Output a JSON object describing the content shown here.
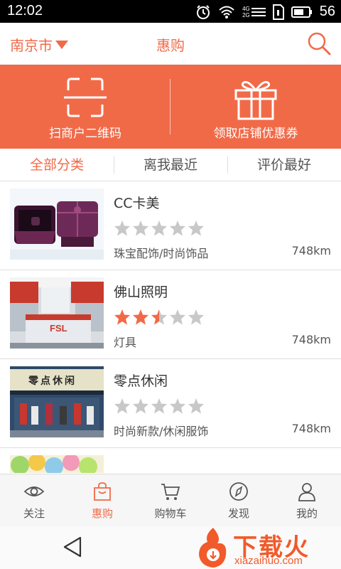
{
  "status": {
    "time": "12:02",
    "battery": "56",
    "signal_4g": "4G",
    "signal_2g": "2G"
  },
  "header": {
    "city": "南京市",
    "title": "惠购"
  },
  "banner": {
    "scan_label": "扫商户二维码",
    "coupon_label": "领取店铺优惠券"
  },
  "tabs": [
    {
      "label": "全部分类"
    },
    {
      "label": "离我最近"
    },
    {
      "label": "评价最好"
    }
  ],
  "stores": [
    {
      "name": "CC卡美",
      "rating": 0,
      "category": "珠宝配饰/时尚饰品",
      "distance": "748km"
    },
    {
      "name": "佛山照明",
      "rating": 2.5,
      "category": "灯具",
      "distance": "748km",
      "sign_text": "FSL"
    },
    {
      "name": "零点休闲",
      "rating": 0,
      "category": "时尚新款/休闲服饰",
      "distance": "748km",
      "sign_text": "零点休闲"
    }
  ],
  "tabbar": [
    {
      "label": "关注",
      "icon": "eye-icon"
    },
    {
      "label": "惠购",
      "icon": "bag-icon"
    },
    {
      "label": "购物车",
      "icon": "cart-icon"
    },
    {
      "label": "发现",
      "icon": "compass-icon"
    },
    {
      "label": "我的",
      "icon": "user-icon"
    }
  ],
  "watermark": {
    "brand": "下载火",
    "domain": "xiazaihuo.com"
  },
  "colors": {
    "accent": "#f16a48",
    "star_on": "#f16a48",
    "star_off": "#c8c8c8"
  }
}
